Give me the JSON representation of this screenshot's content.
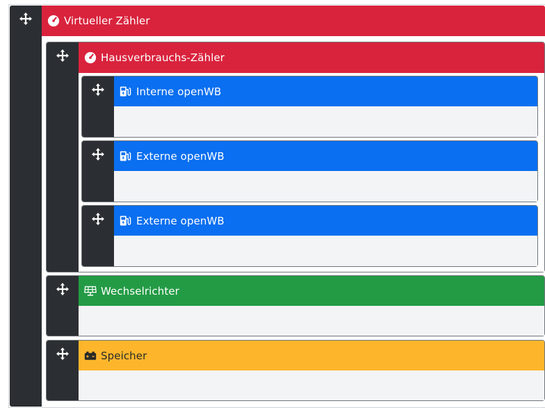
{
  "nodes": {
    "virtual_meter": {
      "title": "Virtueller Zähler",
      "color": "#d9233d",
      "icon": "gauge-icon"
    },
    "house_meter": {
      "title": "Hausverbrauchs-Zähler",
      "color": "#d9233d",
      "icon": "gauge-icon"
    },
    "charge_points": [
      {
        "title": "Interne openWB",
        "color": "#0a6ff0",
        "icon": "charging-station-icon"
      },
      {
        "title": "Externe openWB",
        "color": "#0a6ff0",
        "icon": "charging-station-icon"
      },
      {
        "title": "Externe openWB",
        "color": "#0a6ff0",
        "icon": "charging-station-icon"
      }
    ],
    "inverter": {
      "title": "Wechselrichter",
      "color": "#239b45",
      "icon": "solar-panel-icon"
    },
    "battery": {
      "title": "Speicher",
      "color": "#fdb62b",
      "icon": "battery-icon"
    }
  }
}
